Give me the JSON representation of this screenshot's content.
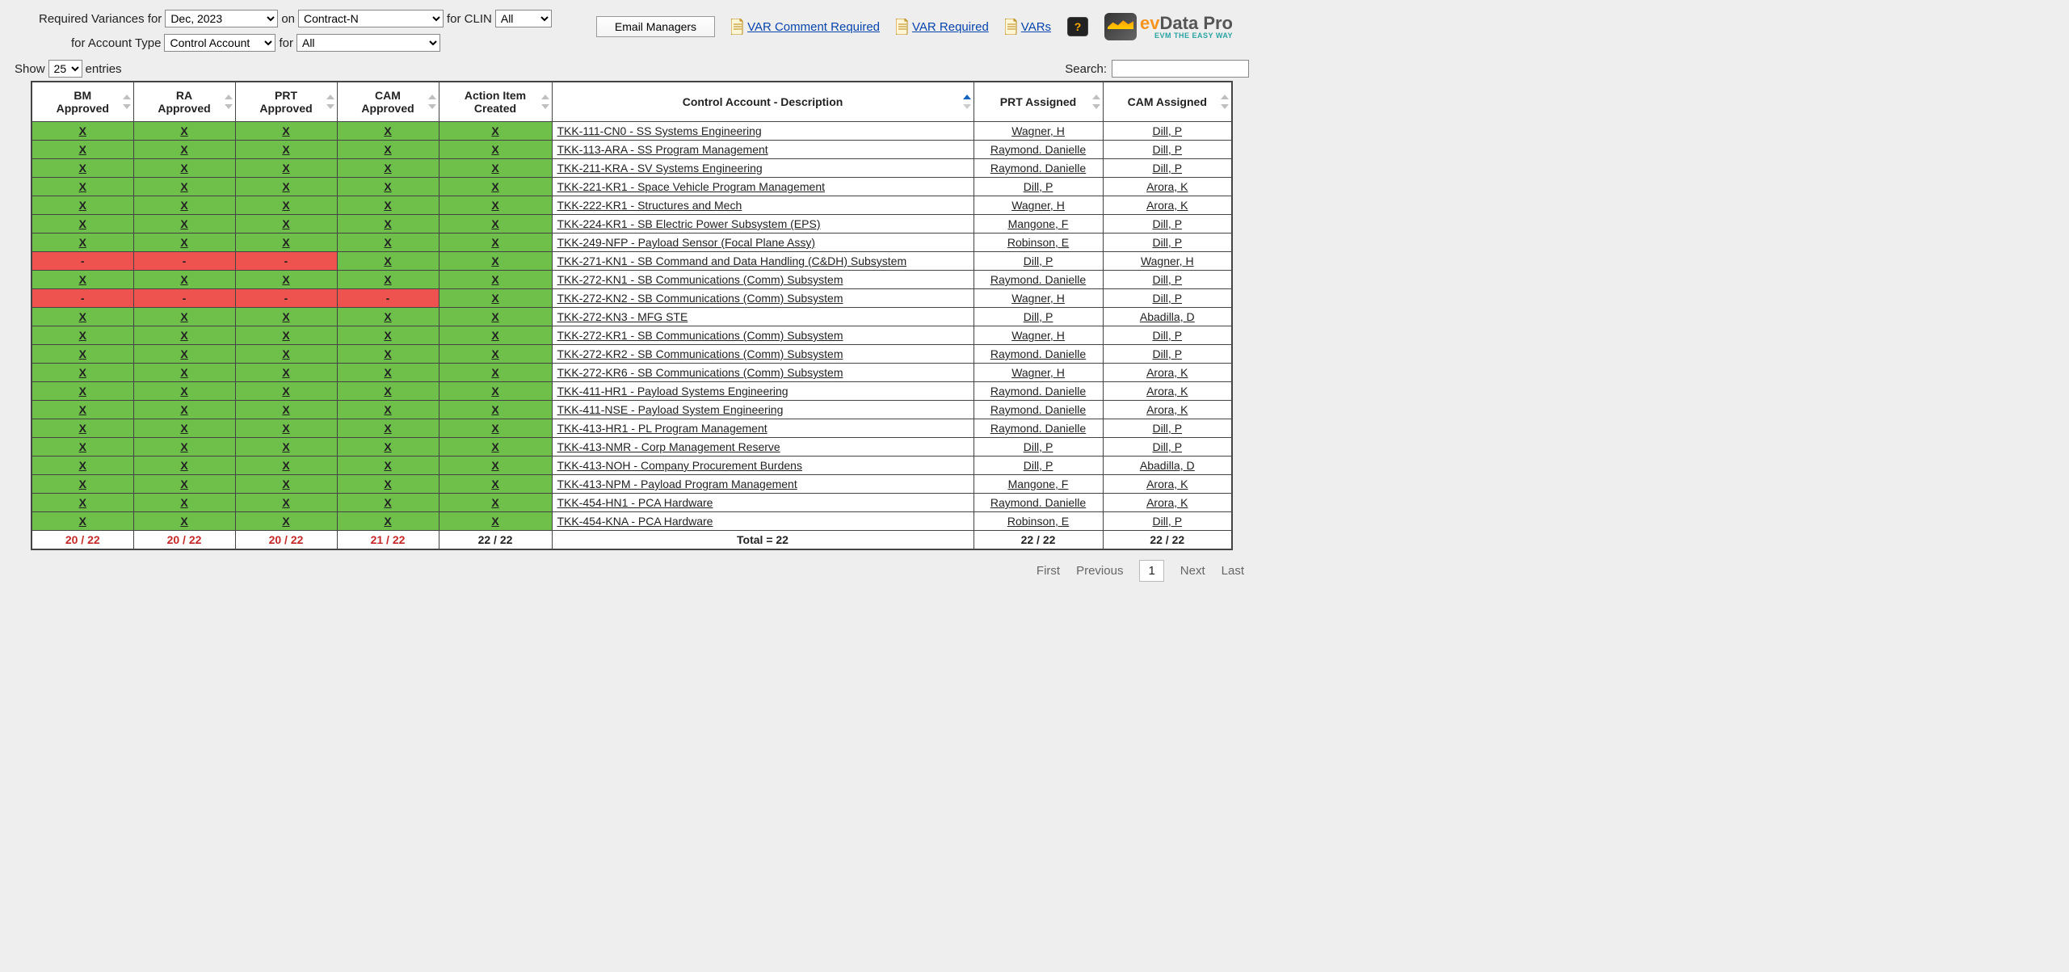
{
  "filters": {
    "label_required_variances_for": "Required Variances for",
    "period_options": [
      "Dec, 2023"
    ],
    "period_selected": "Dec, 2023",
    "label_on": "on",
    "contract_options": [
      "Contract-N"
    ],
    "contract_selected": "Contract-N",
    "label_for_clin": "for CLIN",
    "clin_options": [
      "All"
    ],
    "clin_selected": "All",
    "label_for_account_type": "for Account Type",
    "account_type_options": [
      "Control Account"
    ],
    "account_type_selected": "Control Account",
    "label_for": "for",
    "second_all_options": [
      "All"
    ],
    "second_all_selected": "All"
  },
  "top_actions": {
    "email_managers": "Email Managers",
    "var_comment_required": " VAR Comment Required",
    "var_required": " VAR Required",
    "vars": " VARs"
  },
  "brand": {
    "ev": "ev",
    "data_pro": "Data Pro",
    "tagline": "EVM THE EASY WAY"
  },
  "list_controls": {
    "show_label_pre": "Show",
    "show_options": [
      "25"
    ],
    "show_selected": "25",
    "show_label_post": "entries",
    "search_label": "Search:"
  },
  "columns": {
    "bm": "BM Approved",
    "ra": "RA Approved",
    "prt": "PRT Approved",
    "cam": "CAM Approved",
    "action": "Action Item Created",
    "desc": "Control Account - Description",
    "prt_assigned": "PRT Assigned",
    "cam_assigned": "CAM Assigned"
  },
  "rows": [
    {
      "bm": "X",
      "ra": "X",
      "prt": "X",
      "cam": "X",
      "action": "X",
      "bm_c": "g",
      "ra_c": "g",
      "prt_c": "g",
      "cam_c": "g",
      "action_c": "g",
      "desc": "TKK-111-CN0 - SS Systems Engineering",
      "prt_a": "Wagner, H",
      "cam_a": "Dill, P"
    },
    {
      "bm": "X",
      "ra": "X",
      "prt": "X",
      "cam": "X",
      "action": "X",
      "bm_c": "g",
      "ra_c": "g",
      "prt_c": "g",
      "cam_c": "g",
      "action_c": "g",
      "desc": "TKK-113-ARA - SS Program Management",
      "prt_a": "Raymond. Danielle",
      "cam_a": "Dill, P"
    },
    {
      "bm": "X",
      "ra": "X",
      "prt": "X",
      "cam": "X",
      "action": "X",
      "bm_c": "g",
      "ra_c": "g",
      "prt_c": "g",
      "cam_c": "g",
      "action_c": "g",
      "desc": "TKK-211-KRA - SV Systems Engineering",
      "prt_a": "Raymond. Danielle",
      "cam_a": "Dill, P"
    },
    {
      "bm": "X",
      "ra": "X",
      "prt": "X",
      "cam": "X",
      "action": "X",
      "bm_c": "g",
      "ra_c": "g",
      "prt_c": "g",
      "cam_c": "g",
      "action_c": "g",
      "desc": "TKK-221-KR1 - Space Vehicle Program Management",
      "prt_a": "Dill, P",
      "cam_a": "Arora, K"
    },
    {
      "bm": "X",
      "ra": "X",
      "prt": "X",
      "cam": "X",
      "action": "X",
      "bm_c": "g",
      "ra_c": "g",
      "prt_c": "g",
      "cam_c": "g",
      "action_c": "g",
      "desc": "TKK-222-KR1 - Structures and Mech",
      "prt_a": "Wagner, H",
      "cam_a": "Arora, K"
    },
    {
      "bm": "X",
      "ra": "X",
      "prt": "X",
      "cam": "X",
      "action": "X",
      "bm_c": "g",
      "ra_c": "g",
      "prt_c": "g",
      "cam_c": "g",
      "action_c": "g",
      "desc": "TKK-224-KR1 - SB Electric Power Subsystem (EPS)",
      "prt_a": "Mangone, F",
      "cam_a": "Dill, P"
    },
    {
      "bm": "X",
      "ra": "X",
      "prt": "X",
      "cam": "X",
      "action": "X",
      "bm_c": "g",
      "ra_c": "g",
      "prt_c": "g",
      "cam_c": "g",
      "action_c": "g",
      "desc": "TKK-249-NFP - Payload Sensor (Focal Plane Assy)",
      "prt_a": "Robinson, E",
      "cam_a": "Dill, P"
    },
    {
      "bm": "-",
      "ra": "-",
      "prt": "-",
      "cam": "X",
      "action": "X",
      "bm_c": "r",
      "ra_c": "r",
      "prt_c": "r",
      "cam_c": "g",
      "action_c": "g",
      "desc": "TKK-271-KN1 - SB Command and Data Handling (C&DH) Subsystem",
      "prt_a": "Dill, P",
      "cam_a": "Wagner, H"
    },
    {
      "bm": "X",
      "ra": "X",
      "prt": "X",
      "cam": "X",
      "action": "X",
      "bm_c": "g",
      "ra_c": "g",
      "prt_c": "g",
      "cam_c": "g",
      "action_c": "g",
      "desc": "TKK-272-KN1 - SB Communications (Comm) Subsystem",
      "prt_a": "Raymond. Danielle",
      "cam_a": "Dill, P"
    },
    {
      "bm": "-",
      "ra": "-",
      "prt": "-",
      "cam": "-",
      "action": "X",
      "bm_c": "r",
      "ra_c": "r",
      "prt_c": "r",
      "cam_c": "r",
      "action_c": "g",
      "desc": "TKK-272-KN2 - SB Communications (Comm) Subsystem",
      "prt_a": "Wagner, H",
      "cam_a": "Dill, P"
    },
    {
      "bm": "X",
      "ra": "X",
      "prt": "X",
      "cam": "X",
      "action": "X",
      "bm_c": "g",
      "ra_c": "g",
      "prt_c": "g",
      "cam_c": "g",
      "action_c": "g",
      "desc": "TKK-272-KN3 - MFG STE",
      "prt_a": "Dill, P",
      "cam_a": "Abadilla, D"
    },
    {
      "bm": "X",
      "ra": "X",
      "prt": "X",
      "cam": "X",
      "action": "X",
      "bm_c": "g",
      "ra_c": "g",
      "prt_c": "g",
      "cam_c": "g",
      "action_c": "g",
      "desc": "TKK-272-KR1 - SB Communications (Comm) Subsystem",
      "prt_a": "Wagner, H",
      "cam_a": "Dill, P"
    },
    {
      "bm": "X",
      "ra": "X",
      "prt": "X",
      "cam": "X",
      "action": "X",
      "bm_c": "g",
      "ra_c": "g",
      "prt_c": "g",
      "cam_c": "g",
      "action_c": "g",
      "desc": "TKK-272-KR2 - SB Communications (Comm) Subsystem",
      "prt_a": "Raymond. Danielle",
      "cam_a": "Dill, P"
    },
    {
      "bm": "X",
      "ra": "X",
      "prt": "X",
      "cam": "X",
      "action": "X",
      "bm_c": "g",
      "ra_c": "g",
      "prt_c": "g",
      "cam_c": "g",
      "action_c": "g",
      "desc": "TKK-272-KR6 - SB Communications (Comm) Subsystem",
      "prt_a": "Wagner, H",
      "cam_a": "Arora, K"
    },
    {
      "bm": "X",
      "ra": "X",
      "prt": "X",
      "cam": "X",
      "action": "X",
      "bm_c": "g",
      "ra_c": "g",
      "prt_c": "g",
      "cam_c": "g",
      "action_c": "g",
      "desc": "TKK-411-HR1 - Payload Systems Engineering",
      "prt_a": "Raymond. Danielle",
      "cam_a": "Arora, K"
    },
    {
      "bm": "X",
      "ra": "X",
      "prt": "X",
      "cam": "X",
      "action": "X",
      "bm_c": "g",
      "ra_c": "g",
      "prt_c": "g",
      "cam_c": "g",
      "action_c": "g",
      "desc": "TKK-411-NSE - Payload System Engineering",
      "prt_a": "Raymond. Danielle",
      "cam_a": "Arora, K"
    },
    {
      "bm": "X",
      "ra": "X",
      "prt": "X",
      "cam": "X",
      "action": "X",
      "bm_c": "g",
      "ra_c": "g",
      "prt_c": "g",
      "cam_c": "g",
      "action_c": "g",
      "desc": "TKK-413-HR1 - PL Program Management",
      "prt_a": "Raymond. Danielle",
      "cam_a": "Dill, P"
    },
    {
      "bm": "X",
      "ra": "X",
      "prt": "X",
      "cam": "X",
      "action": "X",
      "bm_c": "g",
      "ra_c": "g",
      "prt_c": "g",
      "cam_c": "g",
      "action_c": "g",
      "desc": "TKK-413-NMR - Corp Management Reserve",
      "prt_a": "Dill, P",
      "cam_a": "Dill, P"
    },
    {
      "bm": "X",
      "ra": "X",
      "prt": "X",
      "cam": "X",
      "action": "X",
      "bm_c": "g",
      "ra_c": "g",
      "prt_c": "g",
      "cam_c": "g",
      "action_c": "g",
      "desc": "TKK-413-NOH - Company Procurement Burdens",
      "prt_a": "Dill, P",
      "cam_a": "Abadilla, D"
    },
    {
      "bm": "X",
      "ra": "X",
      "prt": "X",
      "cam": "X",
      "action": "X",
      "bm_c": "g",
      "ra_c": "g",
      "prt_c": "g",
      "cam_c": "g",
      "action_c": "g",
      "desc": "TKK-413-NPM - Payload Program Management",
      "prt_a": "Mangone, F",
      "cam_a": "Arora, K"
    },
    {
      "bm": "X",
      "ra": "X",
      "prt": "X",
      "cam": "X",
      "action": "X",
      "bm_c": "g",
      "ra_c": "g",
      "prt_c": "g",
      "cam_c": "g",
      "action_c": "g",
      "desc": "TKK-454-HN1 - PCA Hardware",
      "prt_a": "Raymond. Danielle",
      "cam_a": "Arora, K"
    },
    {
      "bm": "X",
      "ra": "X",
      "prt": "X",
      "cam": "X",
      "action": "X",
      "bm_c": "g",
      "ra_c": "g",
      "prt_c": "g",
      "cam_c": "g",
      "action_c": "g",
      "desc": "TKK-454-KNA - PCA Hardware",
      "prt_a": "Robinson, E",
      "cam_a": "Dill, P"
    }
  ],
  "footer": {
    "bm": "20 / 22",
    "ra": "20 / 22",
    "prt": "20 / 22",
    "cam": "21 / 22",
    "action": "22 / 22",
    "desc": "Total = 22",
    "prt_a": "22 / 22",
    "cam_a": "22 / 22"
  },
  "pager": {
    "first": "First",
    "previous": "Previous",
    "page": "1",
    "next": "Next",
    "last": "Last"
  }
}
